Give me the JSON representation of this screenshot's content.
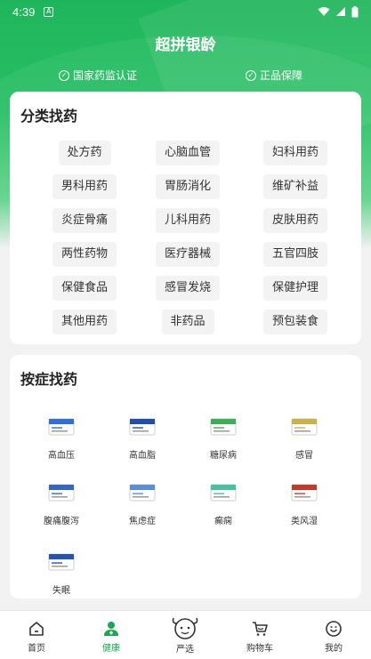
{
  "status_bar": {
    "time": "4:39"
  },
  "header": {
    "title": "超拼银龄",
    "badges": [
      "国家药监认证",
      "正品保障"
    ]
  },
  "categories": {
    "heading": "分类找药",
    "items": [
      "处方药",
      "心脑血管",
      "妇科用药",
      "男科用药",
      "胃肠消化",
      "维矿补益",
      "炎症骨痛",
      "儿科用药",
      "皮肤用药",
      "两性药物",
      "医疗器械",
      "五官四肢",
      "保健食品",
      "感冒发烧",
      "保健护理",
      "其他用药",
      "非药品",
      "预包装食"
    ]
  },
  "symptoms": {
    "heading": "按症找药",
    "items": [
      {
        "label": "高血压",
        "color": "#2f6fd6"
      },
      {
        "label": "高血脂",
        "color": "#1f4fa8"
      },
      {
        "label": "糖尿病",
        "color": "#3cae5a"
      },
      {
        "label": "感冒",
        "color": "#c9b24a"
      },
      {
        "label": "腹痛腹泻",
        "color": "#3467c2"
      },
      {
        "label": "焦虑症",
        "color": "#5a8fd8"
      },
      {
        "label": "癫痫",
        "color": "#4cc0a0"
      },
      {
        "label": "类风湿",
        "color": "#c23a2a"
      },
      {
        "label": "失眠",
        "color": "#2456b0"
      }
    ]
  },
  "tabbar": {
    "items": [
      {
        "label": "首页",
        "icon": "home-icon"
      },
      {
        "label": "健康",
        "icon": "health-icon"
      },
      {
        "label": "严选",
        "icon": "cow-mascot-icon"
      },
      {
        "label": "购物车",
        "icon": "cart-icon"
      },
      {
        "label": "我的",
        "icon": "profile-icon"
      }
    ],
    "active_color": "#1aa84f"
  },
  "colors": {
    "brand": "#22b85f",
    "active": "#1aa84f"
  }
}
